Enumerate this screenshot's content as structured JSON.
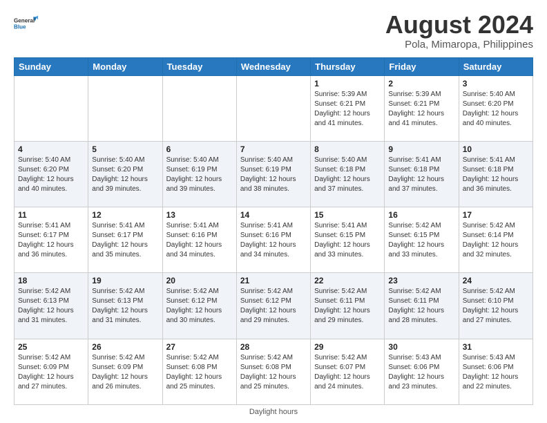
{
  "header": {
    "logo_line1": "General",
    "logo_line2": "Blue",
    "main_title": "August 2024",
    "subtitle": "Pola, Mimaropa, Philippines"
  },
  "days_of_week": [
    "Sunday",
    "Monday",
    "Tuesday",
    "Wednesday",
    "Thursday",
    "Friday",
    "Saturday"
  ],
  "weeks": [
    [
      {
        "day": "",
        "info": ""
      },
      {
        "day": "",
        "info": ""
      },
      {
        "day": "",
        "info": ""
      },
      {
        "day": "",
        "info": ""
      },
      {
        "day": "1",
        "info": "Sunrise: 5:39 AM\nSunset: 6:21 PM\nDaylight: 12 hours\nand 41 minutes."
      },
      {
        "day": "2",
        "info": "Sunrise: 5:39 AM\nSunset: 6:21 PM\nDaylight: 12 hours\nand 41 minutes."
      },
      {
        "day": "3",
        "info": "Sunrise: 5:40 AM\nSunset: 6:20 PM\nDaylight: 12 hours\nand 40 minutes."
      }
    ],
    [
      {
        "day": "4",
        "info": "Sunrise: 5:40 AM\nSunset: 6:20 PM\nDaylight: 12 hours\nand 40 minutes."
      },
      {
        "day": "5",
        "info": "Sunrise: 5:40 AM\nSunset: 6:20 PM\nDaylight: 12 hours\nand 39 minutes."
      },
      {
        "day": "6",
        "info": "Sunrise: 5:40 AM\nSunset: 6:19 PM\nDaylight: 12 hours\nand 39 minutes."
      },
      {
        "day": "7",
        "info": "Sunrise: 5:40 AM\nSunset: 6:19 PM\nDaylight: 12 hours\nand 38 minutes."
      },
      {
        "day": "8",
        "info": "Sunrise: 5:40 AM\nSunset: 6:18 PM\nDaylight: 12 hours\nand 37 minutes."
      },
      {
        "day": "9",
        "info": "Sunrise: 5:41 AM\nSunset: 6:18 PM\nDaylight: 12 hours\nand 37 minutes."
      },
      {
        "day": "10",
        "info": "Sunrise: 5:41 AM\nSunset: 6:18 PM\nDaylight: 12 hours\nand 36 minutes."
      }
    ],
    [
      {
        "day": "11",
        "info": "Sunrise: 5:41 AM\nSunset: 6:17 PM\nDaylight: 12 hours\nand 36 minutes."
      },
      {
        "day": "12",
        "info": "Sunrise: 5:41 AM\nSunset: 6:17 PM\nDaylight: 12 hours\nand 35 minutes."
      },
      {
        "day": "13",
        "info": "Sunrise: 5:41 AM\nSunset: 6:16 PM\nDaylight: 12 hours\nand 34 minutes."
      },
      {
        "day": "14",
        "info": "Sunrise: 5:41 AM\nSunset: 6:16 PM\nDaylight: 12 hours\nand 34 minutes."
      },
      {
        "day": "15",
        "info": "Sunrise: 5:41 AM\nSunset: 6:15 PM\nDaylight: 12 hours\nand 33 minutes."
      },
      {
        "day": "16",
        "info": "Sunrise: 5:42 AM\nSunset: 6:15 PM\nDaylight: 12 hours\nand 33 minutes."
      },
      {
        "day": "17",
        "info": "Sunrise: 5:42 AM\nSunset: 6:14 PM\nDaylight: 12 hours\nand 32 minutes."
      }
    ],
    [
      {
        "day": "18",
        "info": "Sunrise: 5:42 AM\nSunset: 6:13 PM\nDaylight: 12 hours\nand 31 minutes."
      },
      {
        "day": "19",
        "info": "Sunrise: 5:42 AM\nSunset: 6:13 PM\nDaylight: 12 hours\nand 31 minutes."
      },
      {
        "day": "20",
        "info": "Sunrise: 5:42 AM\nSunset: 6:12 PM\nDaylight: 12 hours\nand 30 minutes."
      },
      {
        "day": "21",
        "info": "Sunrise: 5:42 AM\nSunset: 6:12 PM\nDaylight: 12 hours\nand 29 minutes."
      },
      {
        "day": "22",
        "info": "Sunrise: 5:42 AM\nSunset: 6:11 PM\nDaylight: 12 hours\nand 29 minutes."
      },
      {
        "day": "23",
        "info": "Sunrise: 5:42 AM\nSunset: 6:11 PM\nDaylight: 12 hours\nand 28 minutes."
      },
      {
        "day": "24",
        "info": "Sunrise: 5:42 AM\nSunset: 6:10 PM\nDaylight: 12 hours\nand 27 minutes."
      }
    ],
    [
      {
        "day": "25",
        "info": "Sunrise: 5:42 AM\nSunset: 6:09 PM\nDaylight: 12 hours\nand 27 minutes."
      },
      {
        "day": "26",
        "info": "Sunrise: 5:42 AM\nSunset: 6:09 PM\nDaylight: 12 hours\nand 26 minutes."
      },
      {
        "day": "27",
        "info": "Sunrise: 5:42 AM\nSunset: 6:08 PM\nDaylight: 12 hours\nand 25 minutes."
      },
      {
        "day": "28",
        "info": "Sunrise: 5:42 AM\nSunset: 6:08 PM\nDaylight: 12 hours\nand 25 minutes."
      },
      {
        "day": "29",
        "info": "Sunrise: 5:42 AM\nSunset: 6:07 PM\nDaylight: 12 hours\nand 24 minutes."
      },
      {
        "day": "30",
        "info": "Sunrise: 5:43 AM\nSunset: 6:06 PM\nDaylight: 12 hours\nand 23 minutes."
      },
      {
        "day": "31",
        "info": "Sunrise: 5:43 AM\nSunset: 6:06 PM\nDaylight: 12 hours\nand 22 minutes."
      }
    ]
  ],
  "footer": {
    "text": "Daylight hours"
  }
}
